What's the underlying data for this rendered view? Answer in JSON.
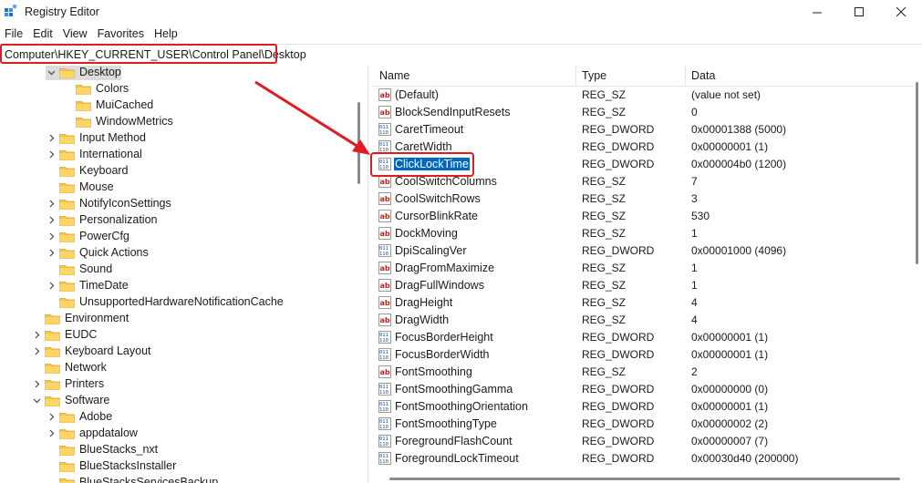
{
  "window": {
    "title": "Registry Editor",
    "icon": "registry-editor-icon",
    "controls": [
      "minimize-icon",
      "maximize-icon",
      "close-icon"
    ]
  },
  "menu": [
    "File",
    "Edit",
    "View",
    "Favorites",
    "Help"
  ],
  "address": "Computer\\HKEY_CURRENT_USER\\Control Panel\\Desktop",
  "tree": [
    {
      "label": "Desktop",
      "expanded": true,
      "selected": true
    },
    {
      "label": "Colors",
      "expanded": false
    },
    {
      "label": "MuiCached",
      "expanded": false
    },
    {
      "label": "WindowMetrics",
      "expanded": false
    },
    {
      "label": "Input Method",
      "collapsed": true
    },
    {
      "label": "International",
      "collapsed": true
    },
    {
      "label": "Keyboard"
    },
    {
      "label": "Mouse"
    },
    {
      "label": "NotifyIconSettings",
      "collapsed": true
    },
    {
      "label": "Personalization",
      "collapsed": true
    },
    {
      "label": "PowerCfg",
      "collapsed": true
    },
    {
      "label": "Quick Actions",
      "collapsed": true
    },
    {
      "label": "Sound"
    },
    {
      "label": "TimeDate",
      "collapsed": true
    },
    {
      "label": "UnsupportedHardwareNotificationCache"
    },
    {
      "label": "Environment"
    },
    {
      "label": "EUDC",
      "collapsed": true
    },
    {
      "label": "Keyboard Layout",
      "collapsed": true
    },
    {
      "label": "Network"
    },
    {
      "label": "Printers",
      "collapsed": true
    },
    {
      "label": "Software",
      "expanded": true
    },
    {
      "label": "Adobe",
      "collapsed": true
    },
    {
      "label": "appdatalow",
      "collapsed": true
    },
    {
      "label": "BlueStacks_nxt"
    },
    {
      "label": "BlueStacksInstaller"
    },
    {
      "label": "BlueStacksServicesBackup"
    }
  ],
  "columns": {
    "name": "Name",
    "type": "Type",
    "data": "Data"
  },
  "values": [
    {
      "name": "(Default)",
      "type": "REG_SZ",
      "data": "(value not set)",
      "kind": "string"
    },
    {
      "name": "BlockSendInputResets",
      "type": "REG_SZ",
      "data": "0",
      "kind": "string"
    },
    {
      "name": "CaretTimeout",
      "type": "REG_DWORD",
      "data": "0x00001388 (5000)",
      "kind": "binary"
    },
    {
      "name": "CaretWidth",
      "type": "REG_DWORD",
      "data": "0x00000001 (1)",
      "kind": "binary"
    },
    {
      "name": "ClickLockTime",
      "type": "REG_DWORD",
      "data": "0x000004b0 (1200)",
      "kind": "binary",
      "selected": true
    },
    {
      "name": "CoolSwitchColumns",
      "type": "REG_SZ",
      "data": "7",
      "kind": "string"
    },
    {
      "name": "CoolSwitchRows",
      "type": "REG_SZ",
      "data": "3",
      "kind": "string"
    },
    {
      "name": "CursorBlinkRate",
      "type": "REG_SZ",
      "data": "530",
      "kind": "string"
    },
    {
      "name": "DockMoving",
      "type": "REG_SZ",
      "data": "1",
      "kind": "string"
    },
    {
      "name": "DpiScalingVer",
      "type": "REG_DWORD",
      "data": "0x00001000 (4096)",
      "kind": "binary"
    },
    {
      "name": "DragFromMaximize",
      "type": "REG_SZ",
      "data": "1",
      "kind": "string"
    },
    {
      "name": "DragFullWindows",
      "type": "REG_SZ",
      "data": "1",
      "kind": "string"
    },
    {
      "name": "DragHeight",
      "type": "REG_SZ",
      "data": "4",
      "kind": "string"
    },
    {
      "name": "DragWidth",
      "type": "REG_SZ",
      "data": "4",
      "kind": "string"
    },
    {
      "name": "FocusBorderHeight",
      "type": "REG_DWORD",
      "data": "0x00000001 (1)",
      "kind": "binary"
    },
    {
      "name": "FocusBorderWidth",
      "type": "REG_DWORD",
      "data": "0x00000001 (1)",
      "kind": "binary"
    },
    {
      "name": "FontSmoothing",
      "type": "REG_SZ",
      "data": "2",
      "kind": "string"
    },
    {
      "name": "FontSmoothingGamma",
      "type": "REG_DWORD",
      "data": "0x00000000 (0)",
      "kind": "binary"
    },
    {
      "name": "FontSmoothingOrientation",
      "type": "REG_DWORD",
      "data": "0x00000001 (1)",
      "kind": "binary"
    },
    {
      "name": "FontSmoothingType",
      "type": "REG_DWORD",
      "data": "0x00000002 (2)",
      "kind": "binary"
    },
    {
      "name": "ForegroundFlashCount",
      "type": "REG_DWORD",
      "data": "0x00000007 (7)",
      "kind": "binary"
    },
    {
      "name": "ForegroundLockTimeout",
      "type": "REG_DWORD",
      "data": "0x00030d40 (200000)",
      "kind": "binary"
    }
  ],
  "colors": {
    "highlight": "#e11b22",
    "selection": "#0067c0",
    "folder": "#f5c24c"
  }
}
